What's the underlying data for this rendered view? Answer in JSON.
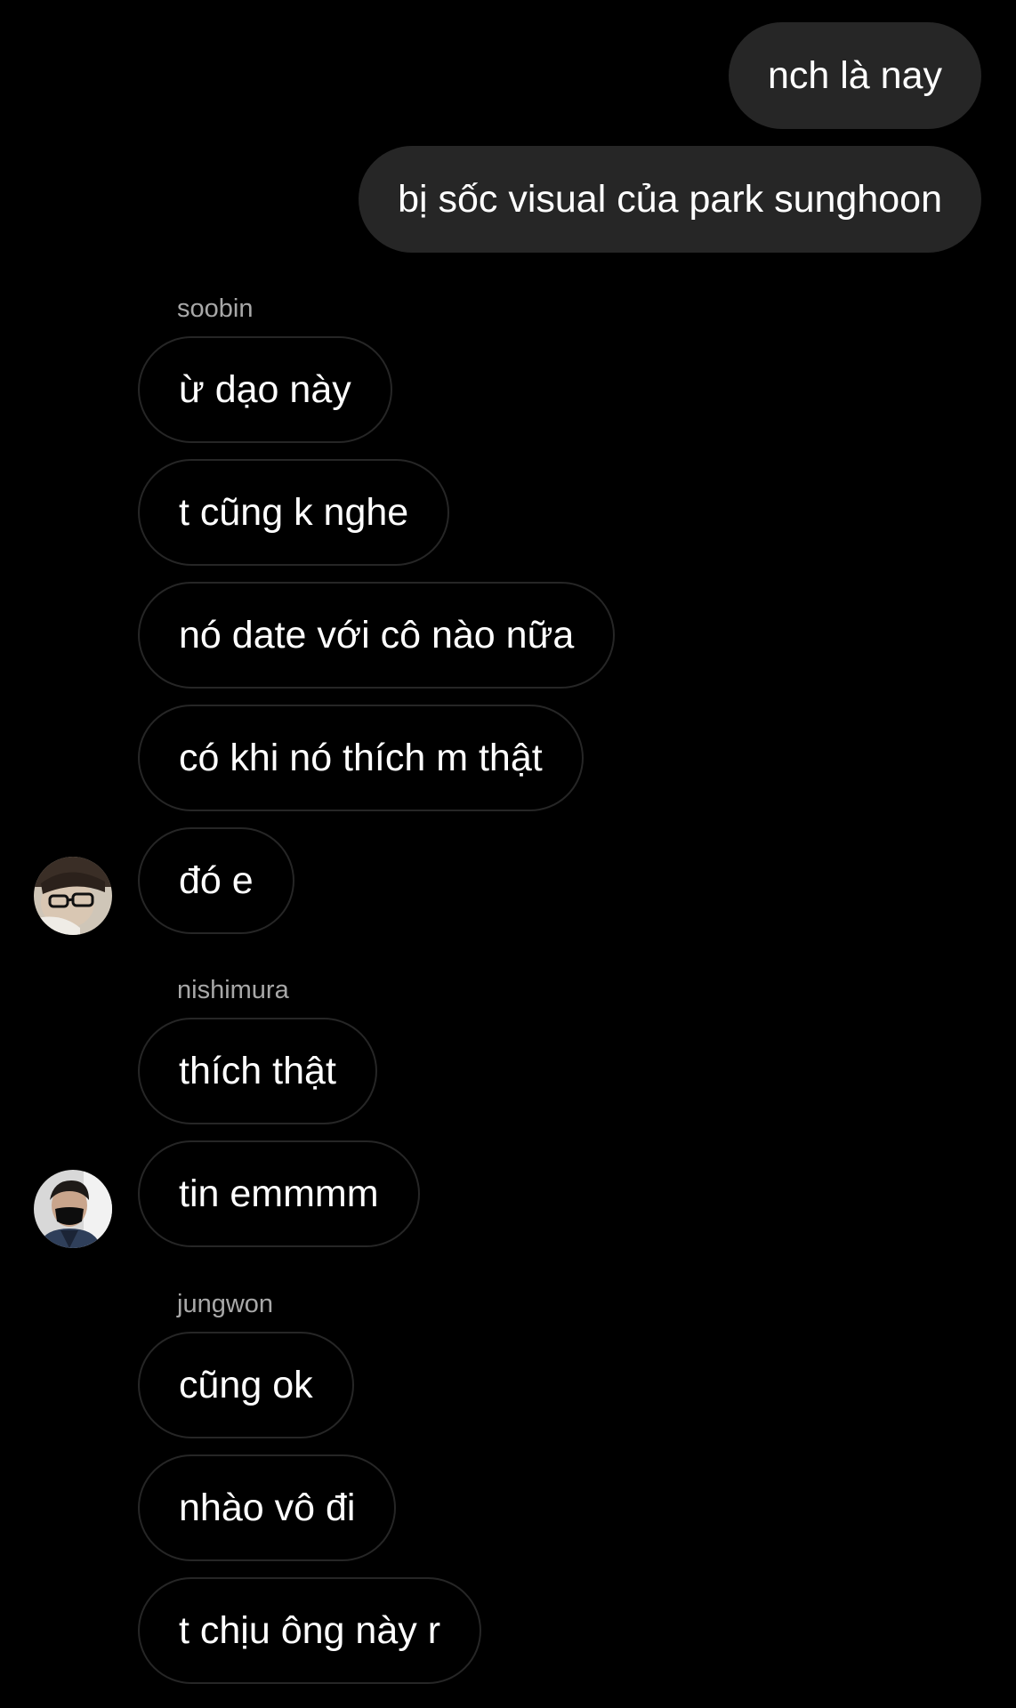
{
  "colors": {
    "background": "#000000",
    "outgoing_bubble": "#262626",
    "incoming_border": "#262626",
    "text": "#ffffff",
    "sender_name": "#a8a8a8"
  },
  "messages": {
    "out": [
      {
        "text": "nch là nay"
      },
      {
        "text": "bị sốc visual của park sunghoon"
      }
    ],
    "groups": [
      {
        "sender": "soobin",
        "avatar_icon": "user-avatar-glasses",
        "items": [
          {
            "text": "ừ dạo này"
          },
          {
            "text": "t cũng k nghe"
          },
          {
            "text": "nó date với cô nào nữa"
          },
          {
            "text": "có khi nó thích m thật"
          },
          {
            "text": "đó e"
          }
        ]
      },
      {
        "sender": "nishimura",
        "avatar_icon": "user-avatar-mask",
        "items": [
          {
            "text": "thích thật"
          },
          {
            "text": "tin emmmm"
          }
        ]
      },
      {
        "sender": "jungwon",
        "items": [
          {
            "text": "cũng ok"
          },
          {
            "text": "nhào vô đi"
          },
          {
            "text": "t chịu ông này r"
          }
        ]
      }
    ]
  }
}
